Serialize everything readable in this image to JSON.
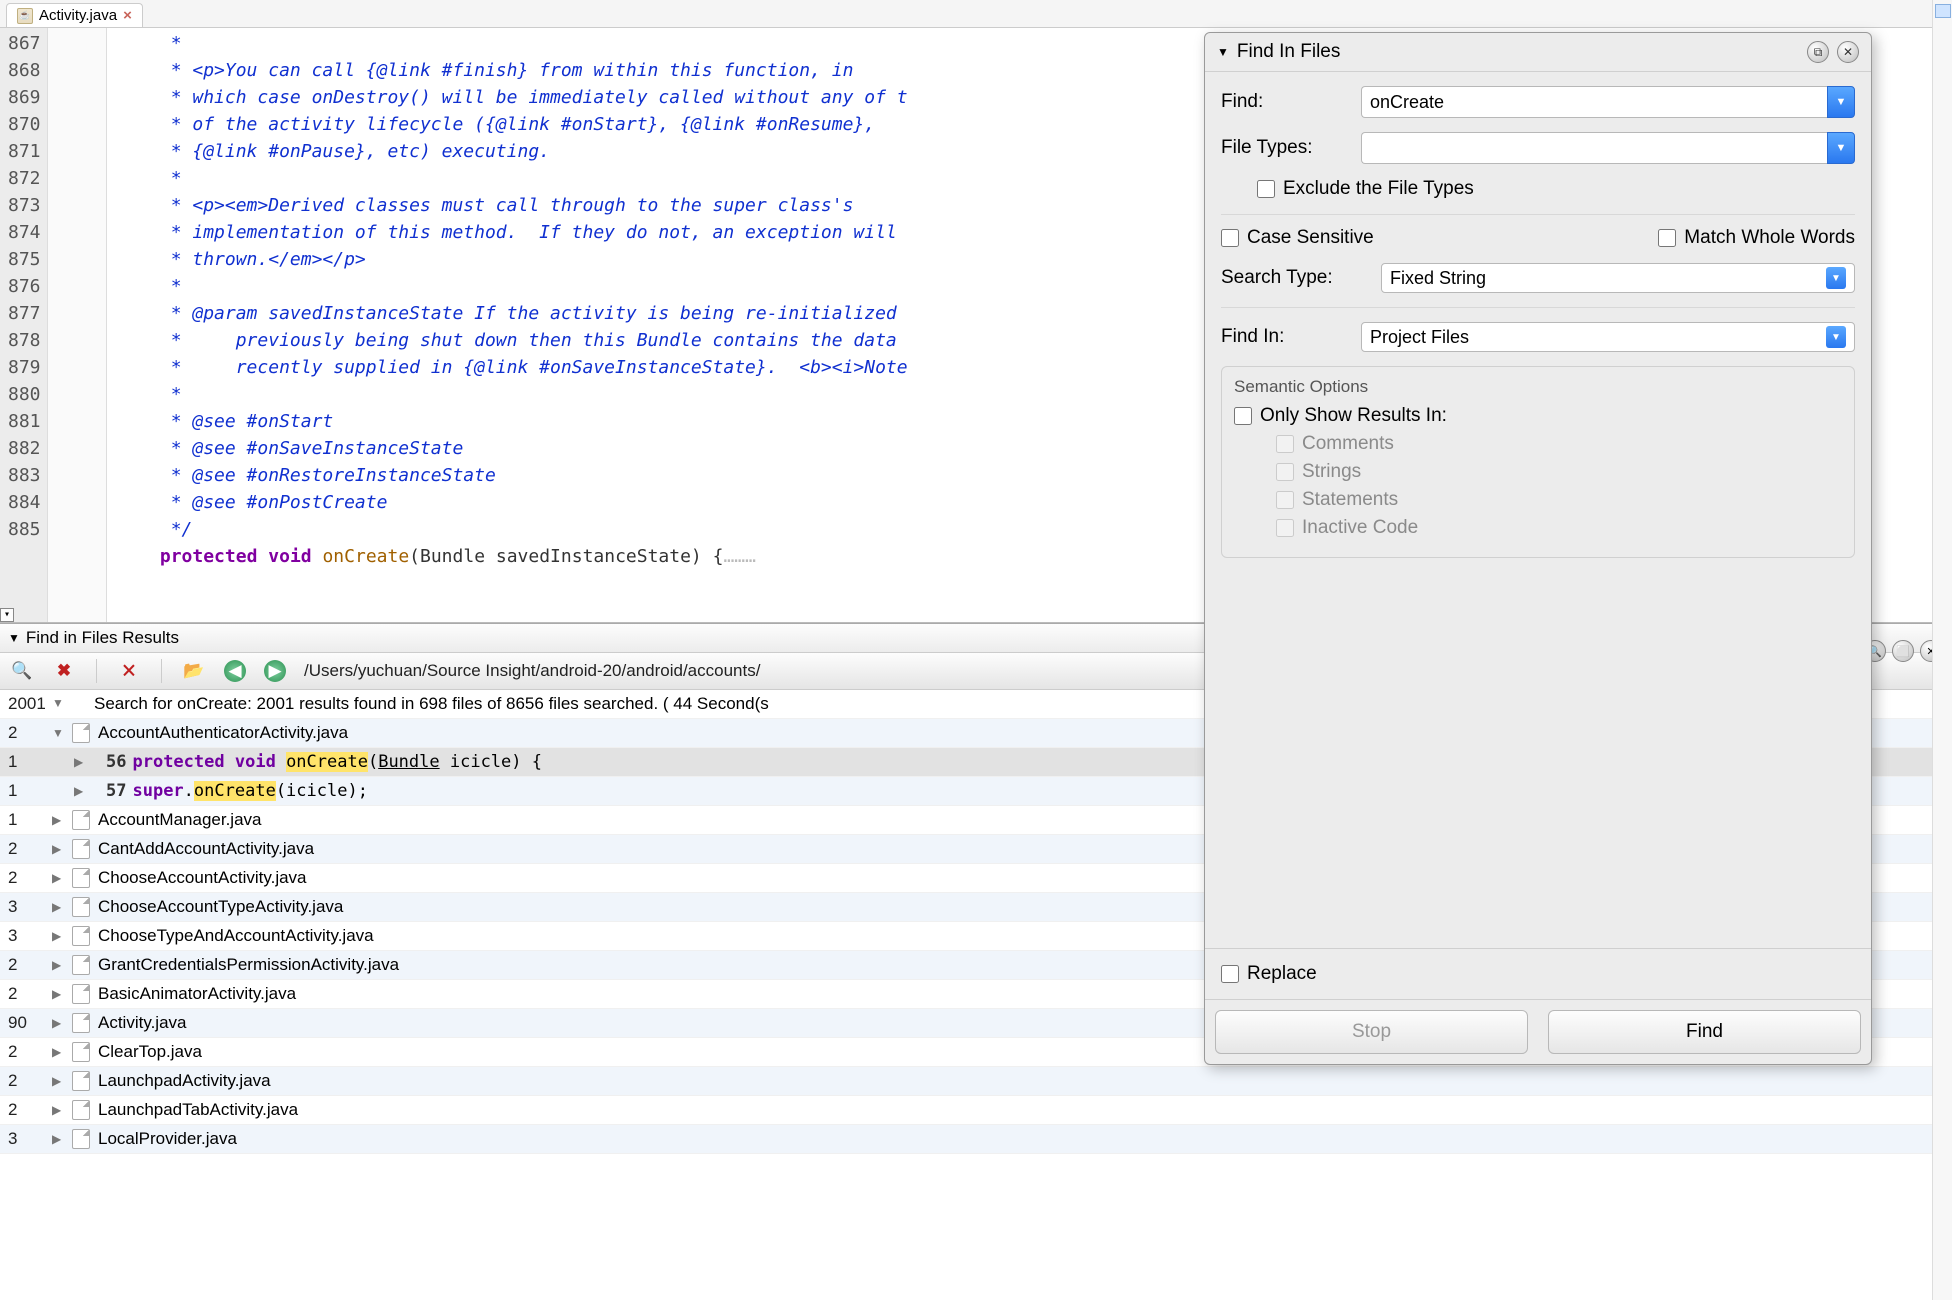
{
  "tab": {
    "filename": "Activity.java"
  },
  "editor": {
    "line_start": 867,
    "line_end": 885,
    "lines": [
      " *",
      " * <p>You can call {@link #finish} from within this function, in",
      " * which case onDestroy() will be immediately called without any of t",
      " * of the activity lifecycle ({@link #onStart}, {@link #onResume},",
      " * {@link #onPause}, etc) executing.",
      " *",
      " * <p><em>Derived classes must call through to the super class's",
      " * implementation of this method.  If they do not, an exception will",
      " * thrown.</em></p>",
      " *",
      " * @param savedInstanceState If the activity is being re-initialized",
      " *     previously being shut down then this Bundle contains the data",
      " *     recently supplied in {@link #onSaveInstanceState}.  <b><i>Note",
      " *",
      " * @see #onStart",
      " * @see #onSaveInstanceState",
      " * @see #onRestoreInstanceState",
      " * @see #onPostCreate",
      " */"
    ],
    "partial_next": "protected void onCreate(Bundle savedInstanceState) {"
  },
  "results": {
    "panel_title": "Find in Files Results",
    "path": "/Users/yuchuan/Source Insight/android-20/android/accounts/",
    "summary_count": "2001",
    "summary_text": "Search for onCreate: 2001 results found in 698 files of 8656 files searched. ( 44 Second(s",
    "rows": [
      {
        "count": "2",
        "expanded": true,
        "file": "AccountAuthenticatorActivity.java",
        "alt": true
      },
      {
        "count": "1",
        "lineNo": "56",
        "code_html": "<span class='kw'>protected</span> <span class='kw'>void</span> <span class='hl'>onCreate</span>(<span class='ty'>Bundle</span> icicle) {",
        "sel": true,
        "indent": 1
      },
      {
        "count": "1",
        "lineNo": "57",
        "code_html": "<span class='kw'>super</span>.<span class='hl'>onCreate</span>(icicle);",
        "alt": true,
        "indent": 1
      },
      {
        "count": "1",
        "file": "AccountManager.java"
      },
      {
        "count": "2",
        "file": "CantAddAccountActivity.java",
        "alt": true
      },
      {
        "count": "2",
        "file": "ChooseAccountActivity.java"
      },
      {
        "count": "3",
        "file": "ChooseAccountTypeActivity.java",
        "alt": true
      },
      {
        "count": "3",
        "file": "ChooseTypeAndAccountActivity.java"
      },
      {
        "count": "2",
        "file": "GrantCredentialsPermissionActivity.java",
        "alt": true
      },
      {
        "count": "2",
        "file": "BasicAnimatorActivity.java"
      },
      {
        "count": "90",
        "file": "Activity.java",
        "alt": true
      },
      {
        "count": "2",
        "file": "ClearTop.java"
      },
      {
        "count": "2",
        "file": "LaunchpadActivity.java",
        "alt": true
      },
      {
        "count": "2",
        "file": "LaunchpadTabActivity.java"
      },
      {
        "count": "3",
        "file": "LocalProvider.java",
        "alt": true
      }
    ]
  },
  "find": {
    "title": "Find In Files",
    "find_label": "Find:",
    "find_value": "onCreate",
    "filetypes_label": "File Types:",
    "filetypes_value": "",
    "exclude_label": "Exclude the File Types",
    "case_label": "Case Sensitive",
    "whole_label": "Match Whole Words",
    "searchtype_label": "Search Type:",
    "searchtype_value": "Fixed String",
    "findin_label": "Find In:",
    "findin_value": "Project Files",
    "semantic_title": "Semantic Options",
    "only_label": "Only Show Results In:",
    "opt_comments": "Comments",
    "opt_strings": "Strings",
    "opt_statements": "Statements",
    "opt_inactive": "Inactive Code",
    "replace_label": "Replace",
    "btn_stop": "Stop",
    "btn_find": "Find"
  }
}
